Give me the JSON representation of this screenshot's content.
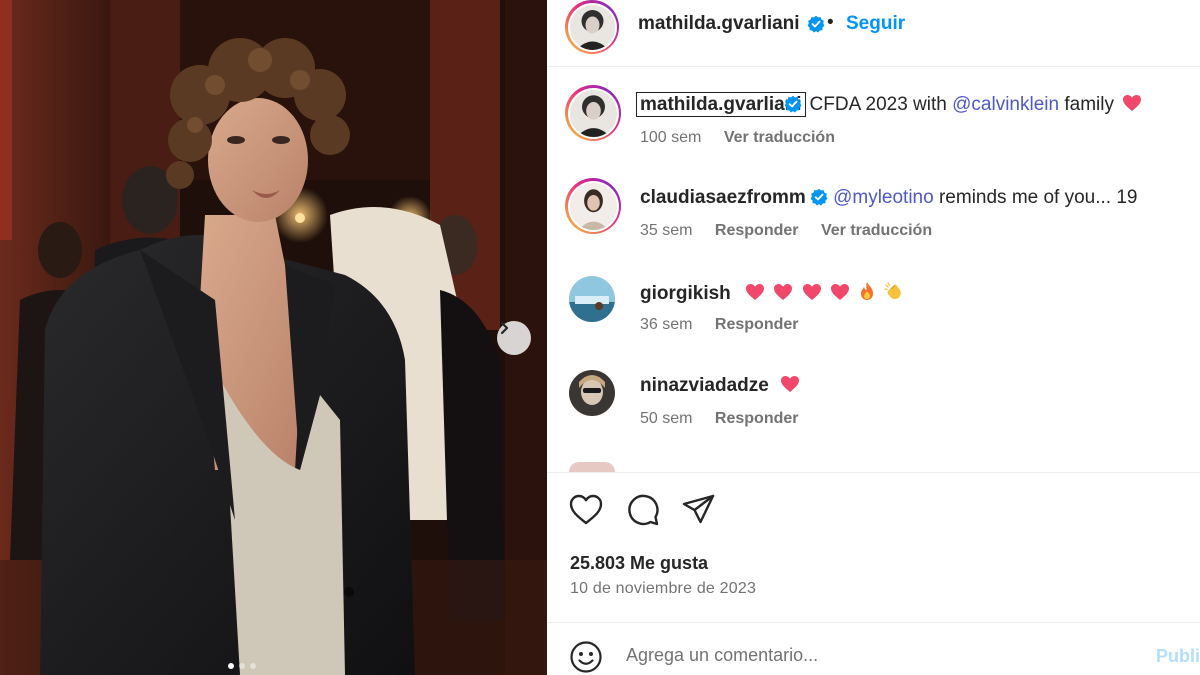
{
  "post": {
    "author": "mathilda.gvarliani",
    "follow_label": "Seguir",
    "bullet": "•",
    "carousel": {
      "count": 3,
      "active_index": 0
    }
  },
  "caption": {
    "username": "mathilda.gvarliani",
    "text_before": "CFDA 2023 with ",
    "mention": "@calvinklein",
    "text_after": " family",
    "emoji": "heart",
    "time": "100 sem",
    "translate": "Ver traducción"
  },
  "comments": [
    {
      "username": "claudiasaezfromm",
      "verified": true,
      "mention": "@myleotino",
      "text": " reminds me of you... 19",
      "time": "35 sem",
      "reply": "Responder",
      "translate": "Ver traducción"
    },
    {
      "username": "giorgikish",
      "verified": false,
      "emojis": [
        "red-heart",
        "red-heart",
        "red-heart",
        "red-heart",
        "fire",
        "clapping-hands"
      ],
      "time": "36 sem",
      "reply": "Responder"
    },
    {
      "username": "ninazviadadze",
      "verified": false,
      "emojis": [
        "red-heart"
      ],
      "time": "50 sem",
      "reply": "Responder"
    }
  ],
  "actions": {
    "icons": [
      "heart-icon",
      "comment-icon",
      "share-icon"
    ]
  },
  "stats": {
    "likes": "25.803 Me gusta",
    "date": "10 de noviembre de 2023"
  },
  "composer": {
    "placeholder": "Agrega un comentario...",
    "publish_label": "Publi"
  },
  "colors": {
    "accent": "#0095f6",
    "mention": "#4f58c9",
    "verified": "#0095f6",
    "heart": "#ed4956"
  }
}
